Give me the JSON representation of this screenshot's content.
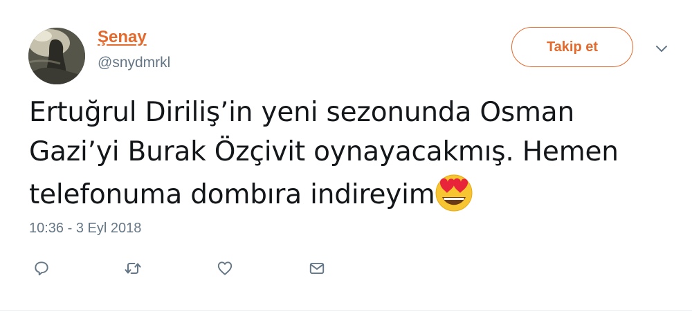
{
  "user": {
    "display_name": "Şenay",
    "handle": "@snydmrkl"
  },
  "follow_button": {
    "label": "Takip et"
  },
  "tweet": {
    "lines": [
      "Ertuğrul Diriliş’in yeni sezonunda Osman",
      "Gazi’yi Burak Özçivit oynayacakmış. Hemen",
      "telefonuma dombıra indireyim"
    ],
    "emoji": "smiling-face-with-heart-eyes",
    "timestamp": "10:36 - 3 Eyl 2018"
  },
  "actions": [
    {
      "name": "reply-icon"
    },
    {
      "name": "retweet-icon"
    },
    {
      "name": "like-icon"
    },
    {
      "name": "direct-message-icon"
    }
  ],
  "colors": {
    "accent": "#e4692c",
    "text": "#14171a",
    "muted": "#657786"
  }
}
